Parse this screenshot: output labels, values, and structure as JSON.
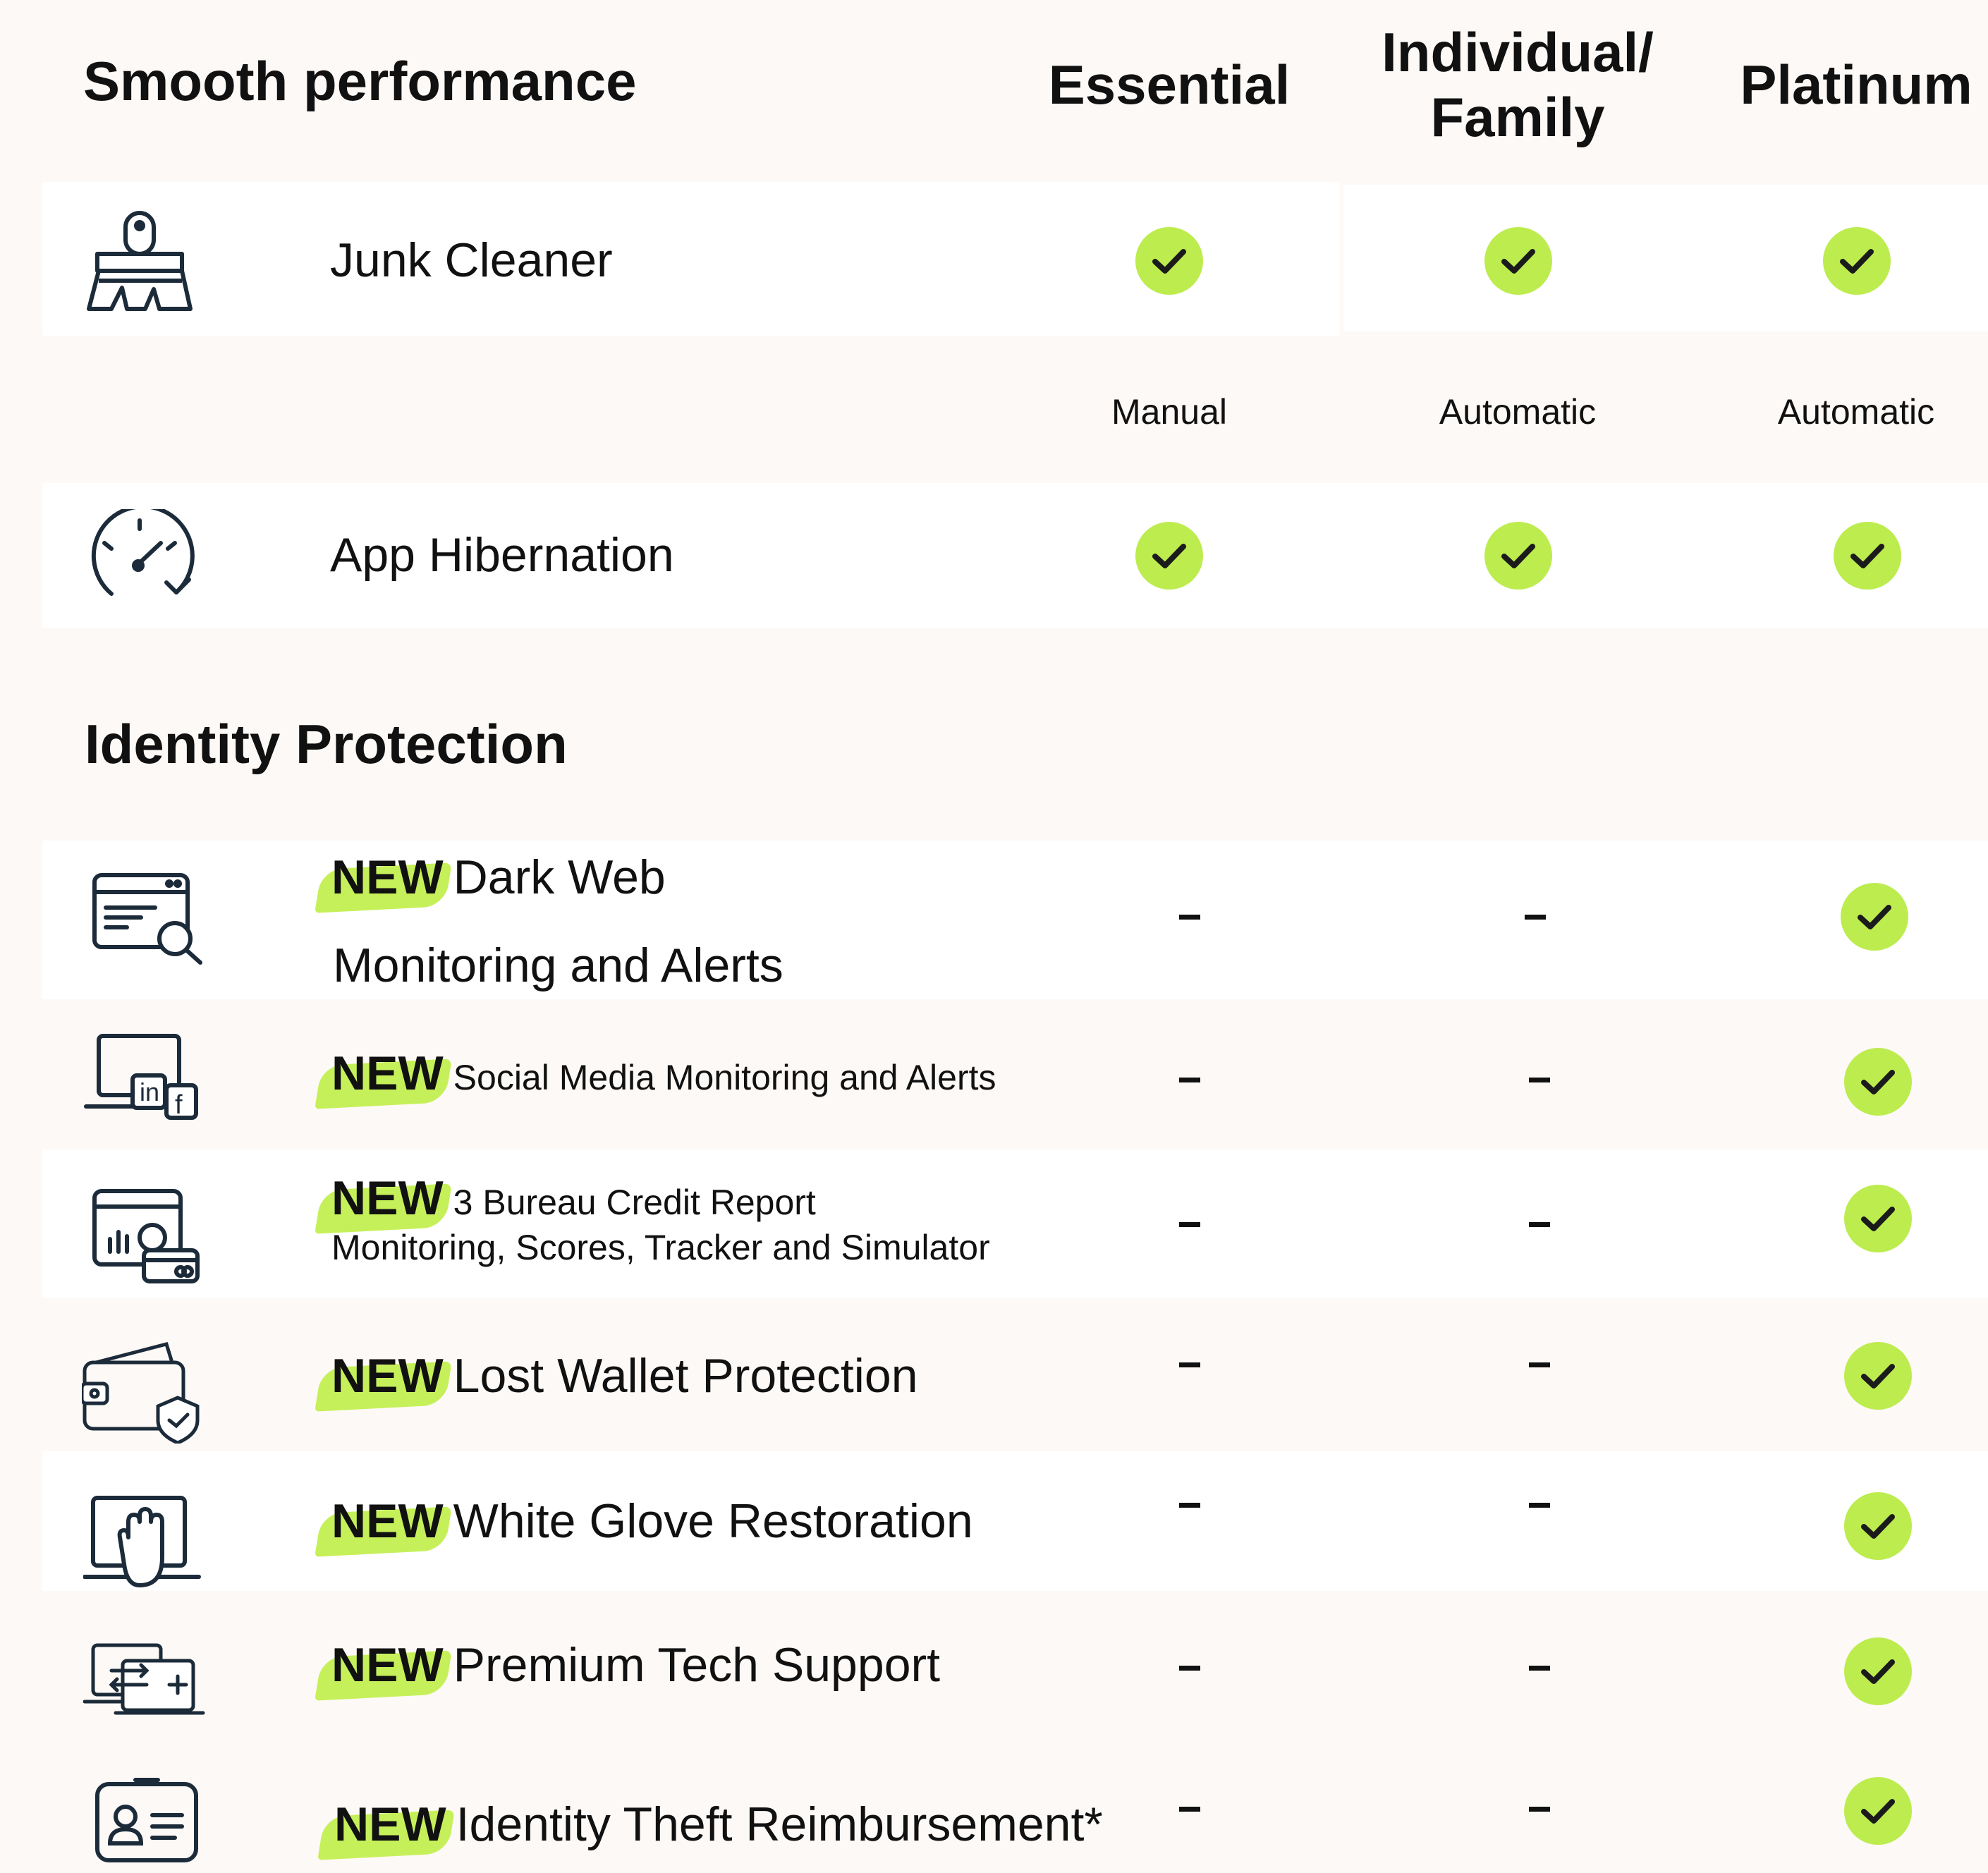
{
  "header": {
    "section_title": "Smooth performance",
    "plans": [
      "Essential",
      "Individual/",
      "Family",
      "Platinum"
    ]
  },
  "smooth": {
    "junk_cleaner": {
      "label": "Junk Cleaner",
      "icon": "broom-icon"
    },
    "junk_notes": [
      "Manual",
      "Automatic",
      "Automatic"
    ],
    "app_hibernation": {
      "label": "App Hibernation",
      "icon": "speedometer-icon"
    }
  },
  "identity": {
    "section_title": "Identity Protection",
    "new_tag": "NEW",
    "rows": [
      {
        "label_line1": "Dark Web",
        "label_line2": "Monitoring and Alerts",
        "icon": "browser-search-icon",
        "essential": "–",
        "family": "–",
        "platinum": "check"
      },
      {
        "label": "Social Media Monitoring and Alerts",
        "icon": "social-devices-icon",
        "essential": "–",
        "family": "–",
        "platinum": "check"
      },
      {
        "label_line1": "3 Bureau Credit Report",
        "label_line2": "Monitoring, Scores, Tracker and Simulator",
        "icon": "credit-report-icon",
        "essential": "–",
        "family": "–",
        "platinum": "check"
      },
      {
        "label": "Lost Wallet Protection",
        "icon": "wallet-shield-icon",
        "essential": "–",
        "family": "–",
        "platinum": "check"
      },
      {
        "label": "White Glove Restoration",
        "icon": "hand-laptop-icon",
        "essential": "–",
        "family": "–",
        "platinum": "check"
      },
      {
        "label": "Premium Tech Support",
        "icon": "remote-support-icon",
        "essential": "–",
        "family": "–",
        "platinum": "check"
      },
      {
        "label": "Identity Theft Reimbursement*",
        "icon": "id-badge-icon",
        "essential": "–",
        "family": "–",
        "platinum": "check"
      }
    ]
  },
  "colors": {
    "background": "#fdf9f6",
    "row": "#ffffff",
    "check_fill": "#bdec4f",
    "new_highlight": "#c6f05a",
    "text": "#111111"
  }
}
